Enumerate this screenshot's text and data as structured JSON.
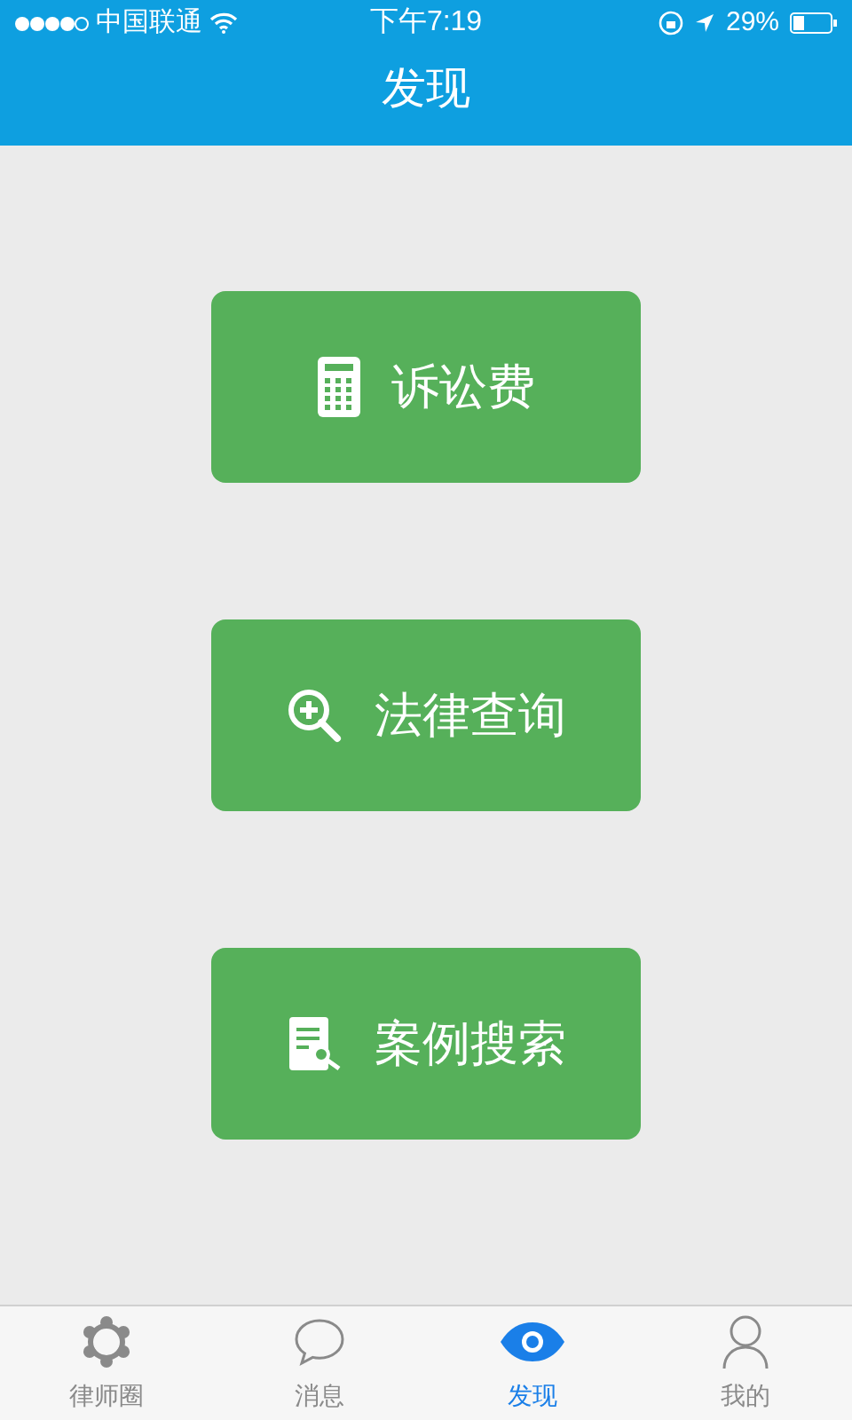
{
  "status_bar": {
    "carrier": "中国联通",
    "time": "下午7:19",
    "battery": "29%"
  },
  "header": {
    "title": "发现"
  },
  "buttons": [
    {
      "kind": "calculator",
      "label": "诉讼费"
    },
    {
      "kind": "search",
      "label": "法律查询"
    },
    {
      "kind": "document",
      "label": "案例搜索"
    }
  ],
  "tab_bar": [
    {
      "kind": "circle",
      "label": "律师圈",
      "selected": false
    },
    {
      "kind": "chat",
      "label": "消息",
      "selected": false
    },
    {
      "kind": "eye",
      "label": "发现",
      "selected": true
    },
    {
      "kind": "person",
      "label": "我的",
      "selected": false
    }
  ]
}
